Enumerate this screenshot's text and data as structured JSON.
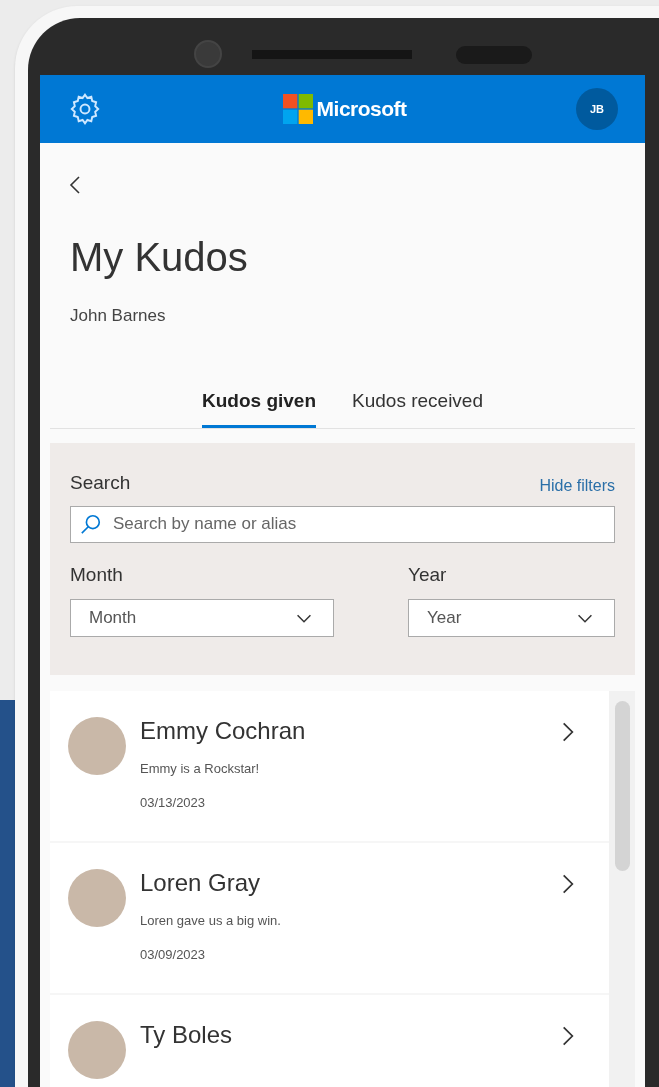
{
  "header": {
    "brand": "Microsoft",
    "avatar_initials": "JB"
  },
  "page": {
    "title": "My Kudos",
    "subtitle": "John Barnes"
  },
  "tabs": [
    {
      "label": "Kudos given",
      "selected": true
    },
    {
      "label": "Kudos received",
      "selected": false
    }
  ],
  "filters": {
    "search_label": "Search",
    "hide_filters": "Hide filters",
    "search": {
      "placeholder": "Search by name or alias"
    },
    "month": {
      "label": "Month",
      "value": "Month"
    },
    "year": {
      "label": "Year",
      "value": "Year"
    }
  },
  "kudos": [
    {
      "name": "Emmy Cochran",
      "message": "Emmy is a Rockstar!",
      "date": "03/13/2023"
    },
    {
      "name": "Loren Gray",
      "message": "Loren gave us a big win.",
      "date": "03/09/2023"
    },
    {
      "name": "Ty Boles"
    }
  ]
}
